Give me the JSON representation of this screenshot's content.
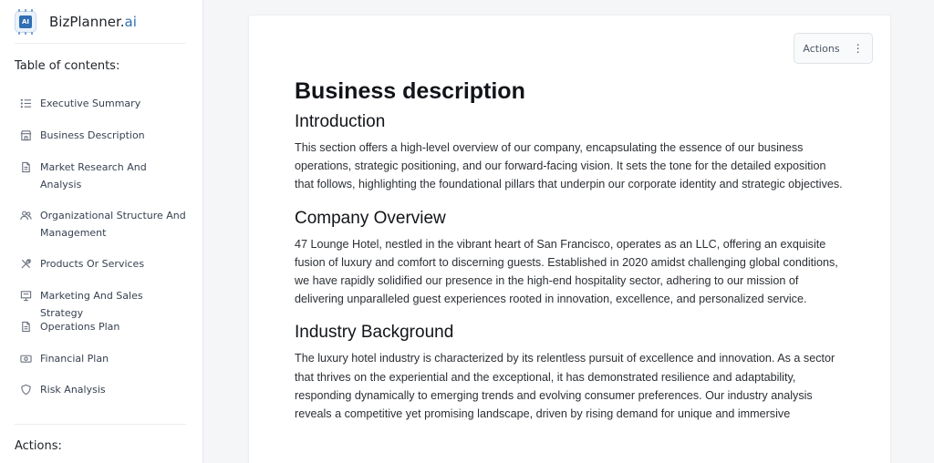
{
  "brand": {
    "name_main": "BizPlanner.",
    "name_ai": "ai",
    "logo_icon": "ai-chip-icon"
  },
  "sidebar": {
    "toc_heading": "Table of contents:",
    "items": [
      {
        "label": "Executive Summary",
        "icon": "list-icon"
      },
      {
        "label": "Business Description",
        "icon": "store-icon"
      },
      {
        "label": "Market Research And Analysis",
        "icon": "document-icon"
      },
      {
        "label": "Organizational Structure And Management",
        "icon": "users-icon"
      },
      {
        "label": "Products Or Services",
        "icon": "tools-icon"
      },
      {
        "label": "Marketing And Sales Strategy",
        "icon": "presentation-icon"
      },
      {
        "label": "Operations Plan",
        "icon": "document-icon"
      },
      {
        "label": "Financial Plan",
        "icon": "money-icon"
      },
      {
        "label": "Risk Analysis",
        "icon": "shield-icon"
      }
    ],
    "actions_heading": "Actions:"
  },
  "document": {
    "actions_label": "Actions",
    "title": "Business description",
    "sections": [
      {
        "heading": "Introduction",
        "body": "This section offers a high-level overview of our company, encapsulating the essence of our business operations, strategic positioning, and our forward-facing vision. It sets the tone for the detailed exposition that follows, highlighting the foundational pillars that underpin our corporate identity and strategic objectives."
      },
      {
        "heading": "Company Overview",
        "body": "47 Lounge Hotel, nestled in the vibrant heart of San Francisco, operates as an LLC, offering an exquisite fusion of luxury and comfort to discerning guests. Established in 2020 amidst challenging global conditions, we have rapidly solidified our presence in the high-end hospitality sector, adhering to our mission of delivering unparalleled guest experiences rooted in innovation, excellence, and personalized service."
      },
      {
        "heading": "Industry Background",
        "body": "The luxury hotel industry is characterized by its relentless pursuit of excellence and innovation. As a sector that thrives on the experiential and the exceptional, it has demonstrated resilience and adaptability, responding dynamically to emerging trends and evolving consumer preferences. Our industry analysis reveals a competitive yet promising landscape, driven by rising demand for unique and immersive"
      }
    ]
  },
  "colors": {
    "accent": "#2f6fb3",
    "sidebar_bg": "#ffffff",
    "page_bg": "#f5f6f8"
  }
}
